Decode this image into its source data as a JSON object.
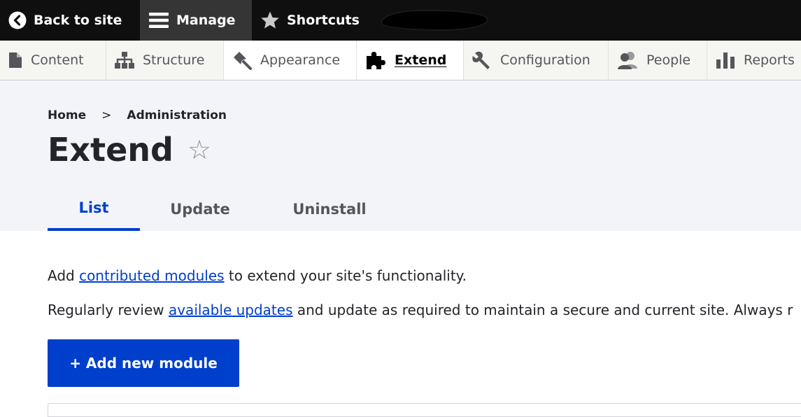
{
  "toolbar": {
    "back_label": "Back to site",
    "manage_label": "Manage",
    "shortcuts_label": "Shortcuts"
  },
  "admin_menu": {
    "items": [
      {
        "label": "Content",
        "icon": "file-icon"
      },
      {
        "label": "Structure",
        "icon": "sitemap-icon"
      },
      {
        "label": "Appearance",
        "icon": "paintbrush-icon"
      },
      {
        "label": "Extend",
        "icon": "puzzle-icon"
      },
      {
        "label": "Configuration",
        "icon": "wrench-icon"
      },
      {
        "label": "People",
        "icon": "people-icon"
      },
      {
        "label": "Reports",
        "icon": "bar-chart-icon"
      }
    ],
    "active": "Extend"
  },
  "breadcrumb": {
    "home": "Home",
    "separator": ">",
    "administration": "Administration"
  },
  "page": {
    "title": "Extend",
    "star_glyph": "☆"
  },
  "tabs": [
    {
      "label": "List",
      "active": true
    },
    {
      "label": "Update",
      "active": false
    },
    {
      "label": "Uninstall",
      "active": false
    }
  ],
  "content": {
    "intro_prefix": "Add ",
    "intro_link": "contributed modules",
    "intro_suffix": " to extend your site's functionality.",
    "review_prefix": "Regularly review ",
    "review_link": "available updates",
    "review_suffix": " and update as required to maintain a secure and current site. Always r",
    "add_button": "+ Add new module"
  },
  "colors": {
    "accent": "#003ecc",
    "toolbar_bg": "#0f0f0f",
    "header_bg": "#f3f4f9"
  }
}
